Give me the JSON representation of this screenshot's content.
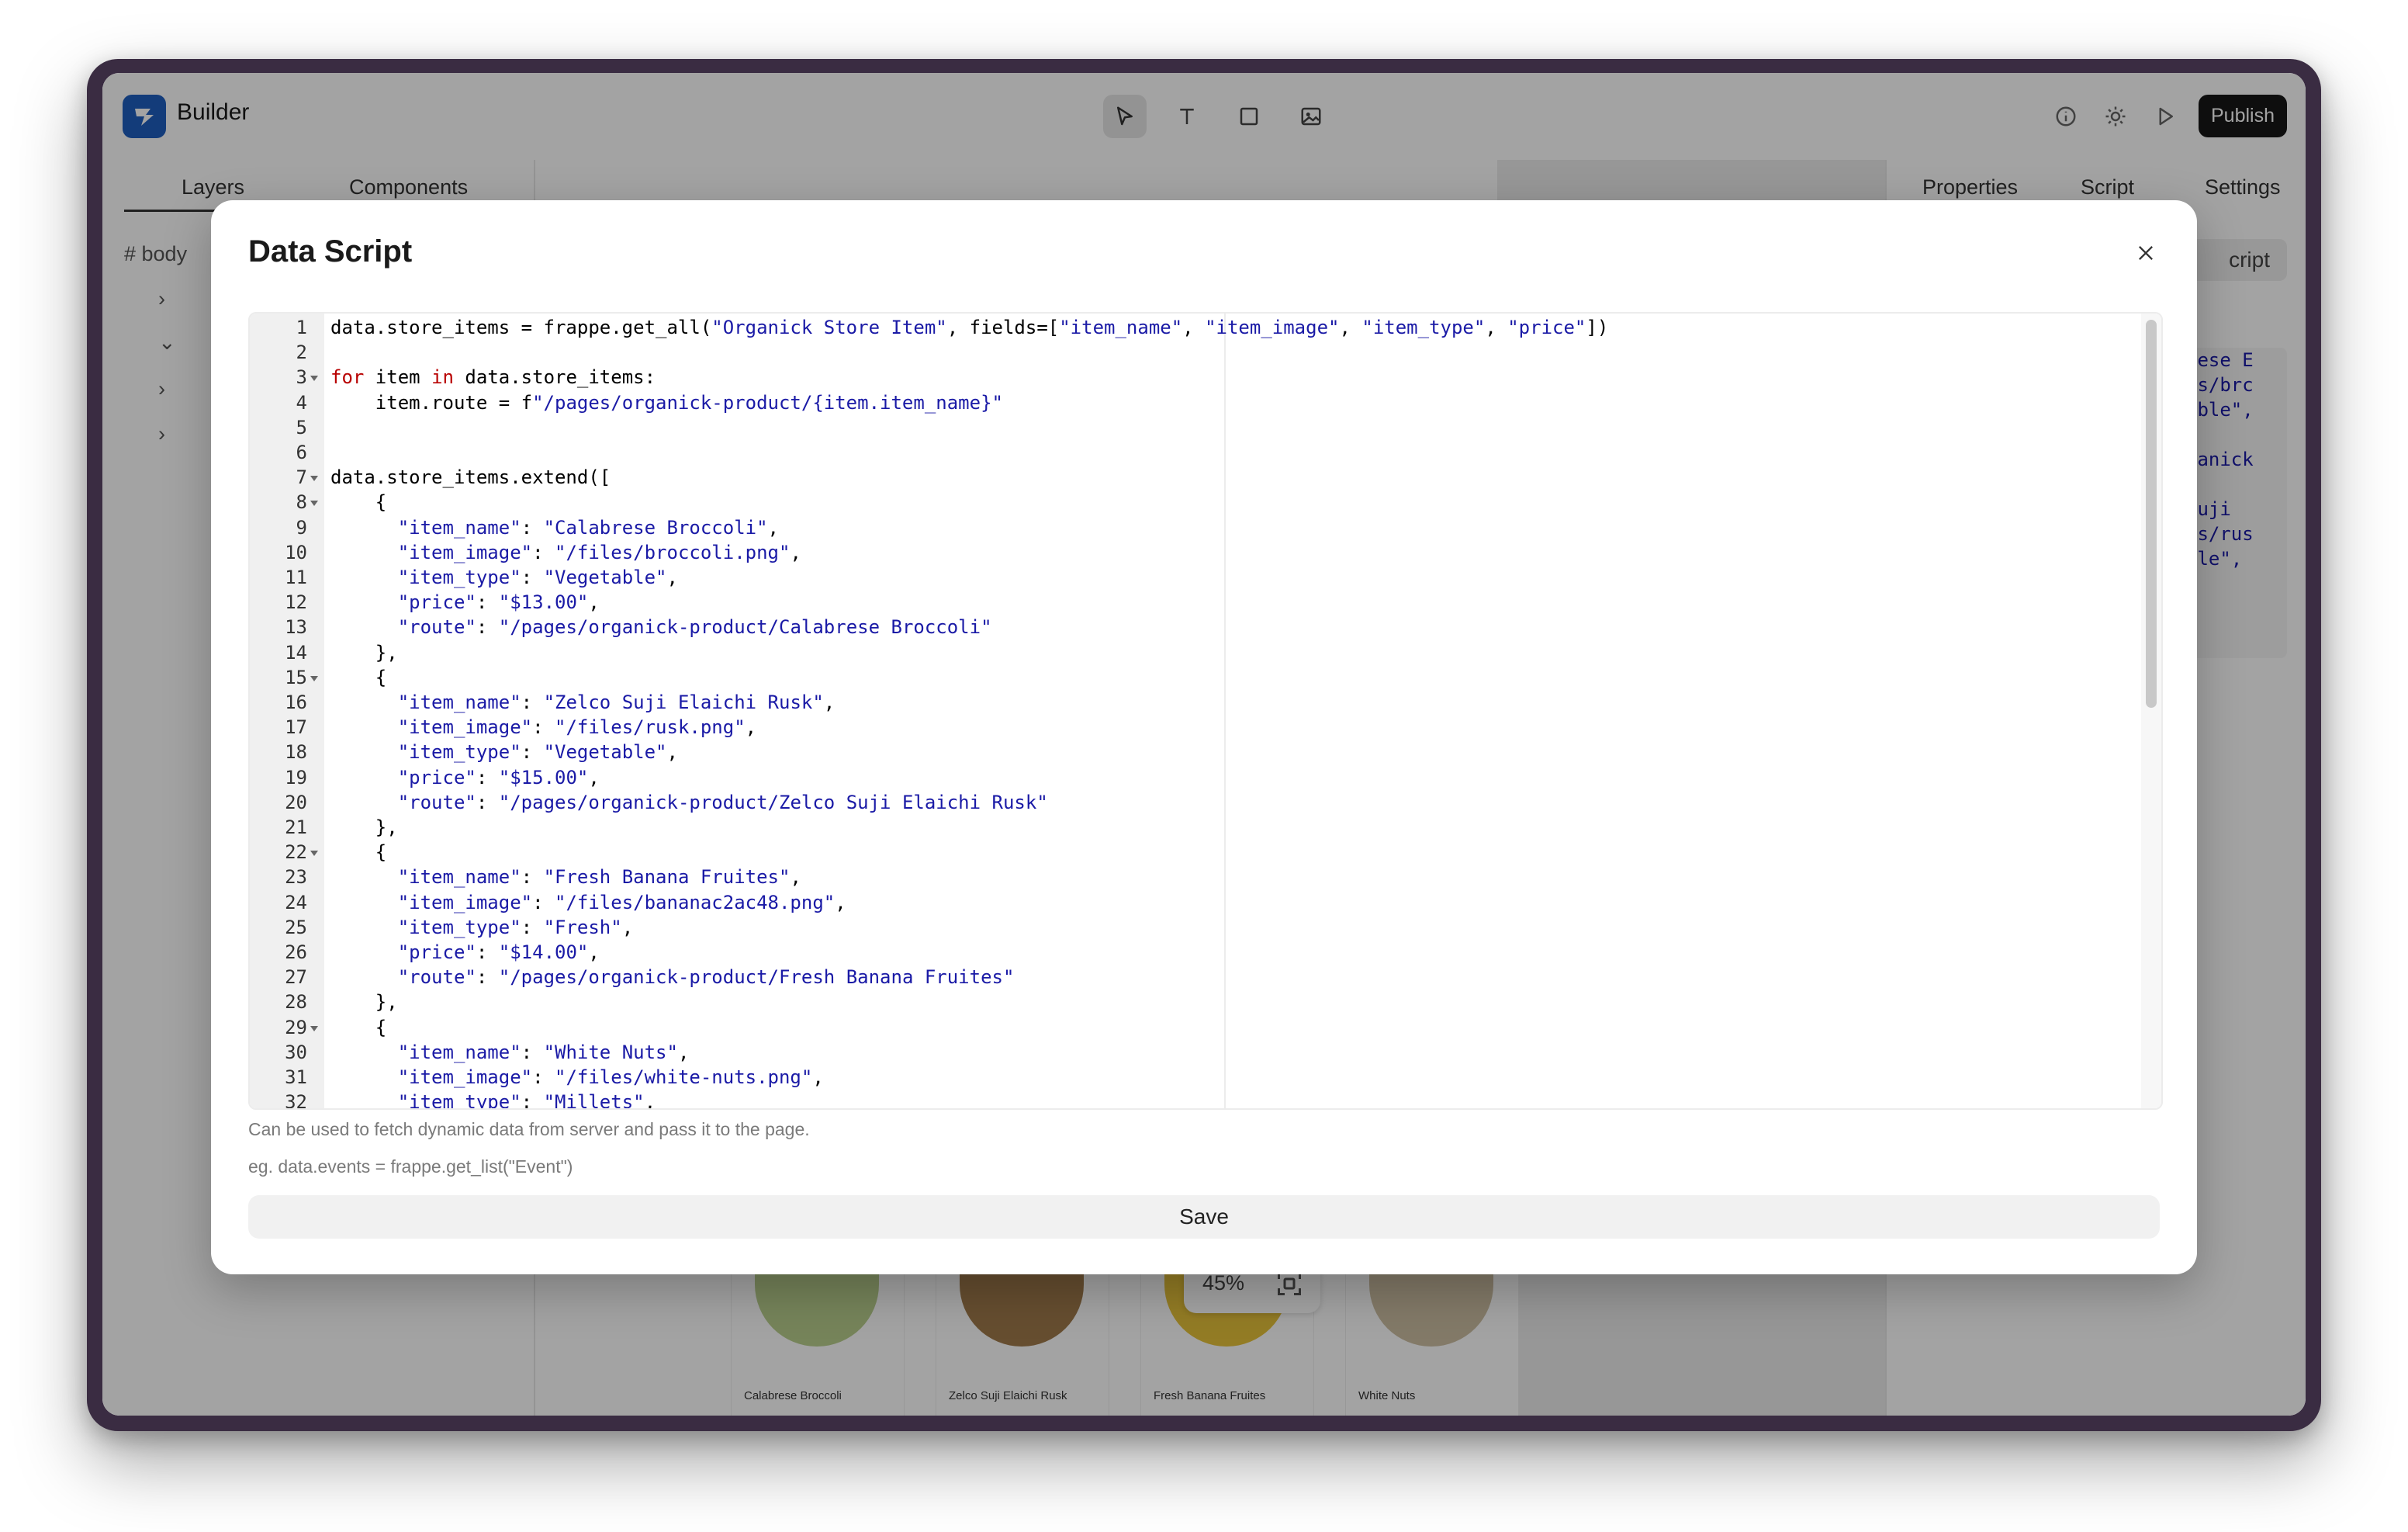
{
  "app": {
    "title": "Builder",
    "publish_label": "Publish"
  },
  "left_panel": {
    "tabs": [
      "Layers",
      "Components"
    ],
    "rows": [
      {
        "label": "# body"
      },
      {
        "label": "›"
      },
      {
        "label": "⌄"
      },
      {
        "label": "›"
      },
      {
        "label": "›"
      }
    ]
  },
  "right_panel": {
    "tabs": [
      "Properties",
      "Script",
      "Settings"
    ],
    "button_partial": "cript",
    "code_partial": [
      "rese E",
      "es/brc",
      "able\",",
      "",
      "ganick",
      "",
      "Suji",
      "es/rus",
      "ble\","
    ]
  },
  "canvas": {
    "zoom": "45%",
    "products": [
      "Calabrese Broccoli",
      "Zelco Suji Elaichi Rusk",
      "Fresh Banana Fruites",
      "White Nuts"
    ]
  },
  "modal": {
    "title": "Data Script",
    "help_text": "Can be used to fetch dynamic data from server and pass it to the page.",
    "example_text": "eg. data.events = frappe.get_list(\"Event\")",
    "save_label": "Save",
    "code_lines": [
      "data.store_items = frappe.get_all(\"Organick Store Item\", fields=[\"item_name\", \"item_image\", \"item_type\", \"price\"])",
      "",
      "for item in data.store_items:",
      "    item.route = f\"/pages/organick-product/{item.item_name}\"",
      "",
      "",
      "data.store_items.extend([",
      "    {",
      "      \"item_name\": \"Calabrese Broccoli\",",
      "      \"item_image\": \"/files/broccoli.png\",",
      "      \"item_type\": \"Vegetable\",",
      "      \"price\": \"$13.00\",",
      "      \"route\": \"/pages/organick-product/Calabrese Broccoli\"",
      "    },",
      "    {",
      "      \"item_name\": \"Zelco Suji Elaichi Rusk\",",
      "      \"item_image\": \"/files/rusk.png\",",
      "      \"item_type\": \"Vegetable\",",
      "      \"price\": \"$15.00\",",
      "      \"route\": \"/pages/organick-product/Zelco Suji Elaichi Rusk\"",
      "    },",
      "    {",
      "      \"item_name\": \"Fresh Banana Fruites\",",
      "      \"item_image\": \"/files/bananac2ac48.png\",",
      "      \"item_type\": \"Fresh\",",
      "      \"price\": \"$14.00\",",
      "      \"route\": \"/pages/organick-product/Fresh Banana Fruites\"",
      "    },",
      "    {",
      "      \"item_name\": \"White Nuts\",",
      "      \"item_image\": \"/files/white-nuts.png\",",
      "      \"item_type\": \"Millets\","
    ],
    "fold_lines": [
      3,
      7,
      8,
      15,
      22,
      29
    ]
  },
  "colors": {
    "brand": "#1f5fbf",
    "keyword": "#b80000",
    "string": "#1a1aa6",
    "overlay": "rgba(0,0,0,0.36)"
  }
}
